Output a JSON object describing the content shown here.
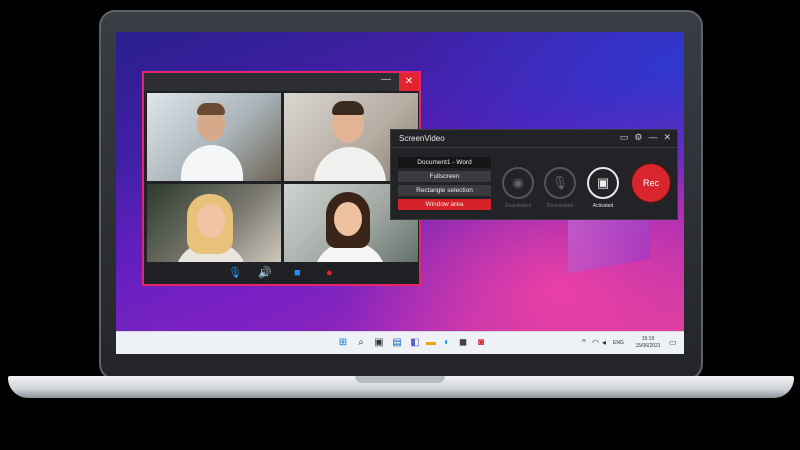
{
  "call_window": {
    "minimize_icon": "minimize-icon",
    "close_icon": "close-icon",
    "toolbar": [
      "microphone-icon",
      "speaker-icon",
      "camera-icon",
      "record-icon"
    ],
    "toolbar_color": "#1e90ff",
    "record_color": "#e3232e"
  },
  "recorder": {
    "title": "ScreenVideo",
    "header_icons": [
      "folder-icon",
      "gear-icon",
      "minimize-icon",
      "close-icon"
    ],
    "capture_options": [
      {
        "label": "Document1 - Word",
        "state": "dark"
      },
      {
        "label": "Fullscreen",
        "state": "normal"
      },
      {
        "label": "Rectangle selection",
        "state": "normal"
      },
      {
        "label": "Window area",
        "state": "selected"
      }
    ],
    "devices": [
      {
        "icon": "webcam-icon",
        "label": "Deactivated"
      },
      {
        "icon": "microphone-icon",
        "label": "Deactivated"
      },
      {
        "icon": "speaker-icon",
        "label": "Activated"
      }
    ],
    "rec_label": "Rec",
    "accent": "#d62228"
  },
  "taskbar": {
    "apps": [
      "windows-start-icon",
      "search-icon",
      "task-view-icon",
      "widgets-icon",
      "chat-icon",
      "file-explorer-icon",
      "edge-icon",
      "store-icon",
      "screenvideo-icon"
    ],
    "tray_icons": [
      "chevron-up-icon",
      "wifi-icon",
      "volume-icon"
    ],
    "language": "ENG",
    "time": "15:19",
    "date": "15/06/2021",
    "notification_icon": "notification-icon"
  }
}
